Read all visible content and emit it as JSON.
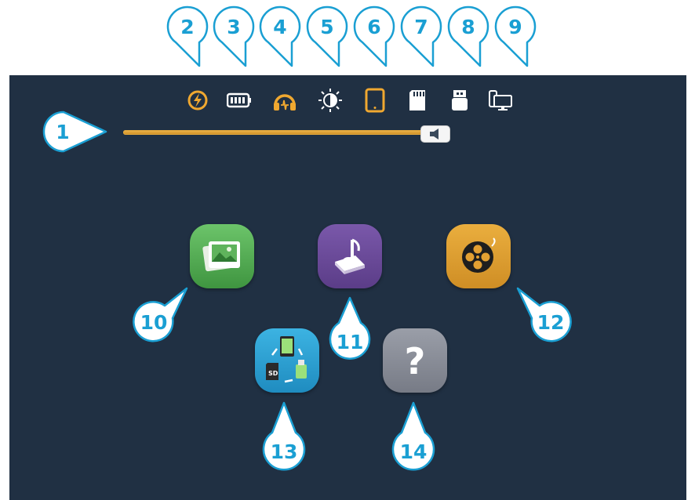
{
  "colors": {
    "screen_bg": "#203043",
    "accent_orange": "#f0a830",
    "callout_blue": "#1a9fd3",
    "gallery_green": "#4fa84e",
    "music_purple": "#6b4a9a",
    "video_orange": "#e3a032",
    "transfer_blue": "#2ea4d6",
    "help_gray": "#8b8f9a"
  },
  "callouts": {
    "c1": "1",
    "c2": "2",
    "c3": "3",
    "c4": "4",
    "c5": "5",
    "c6": "6",
    "c7": "7",
    "c8": "8",
    "c9": "9",
    "c10": "10",
    "c11": "11",
    "c12": "12",
    "c13": "13",
    "c14": "14"
  },
  "status_bar": [
    {
      "icon": "charging-icon"
    },
    {
      "icon": "battery-icon"
    },
    {
      "icon": "headphones-icon"
    },
    {
      "icon": "brightness-icon"
    },
    {
      "icon": "tablet-icon"
    },
    {
      "icon": "sd-card-icon"
    },
    {
      "icon": "usb-drive-icon"
    },
    {
      "icon": "display-output-icon"
    }
  ],
  "volume": {
    "level": 0.93,
    "icon": "speaker-icon"
  },
  "apps": [
    {
      "icon": "photo-gallery-icon"
    },
    {
      "icon": "music-book-icon"
    },
    {
      "icon": "film-reel-icon"
    },
    {
      "icon": "file-transfer-icon"
    },
    {
      "icon": "help-icon",
      "glyph": "?"
    }
  ]
}
